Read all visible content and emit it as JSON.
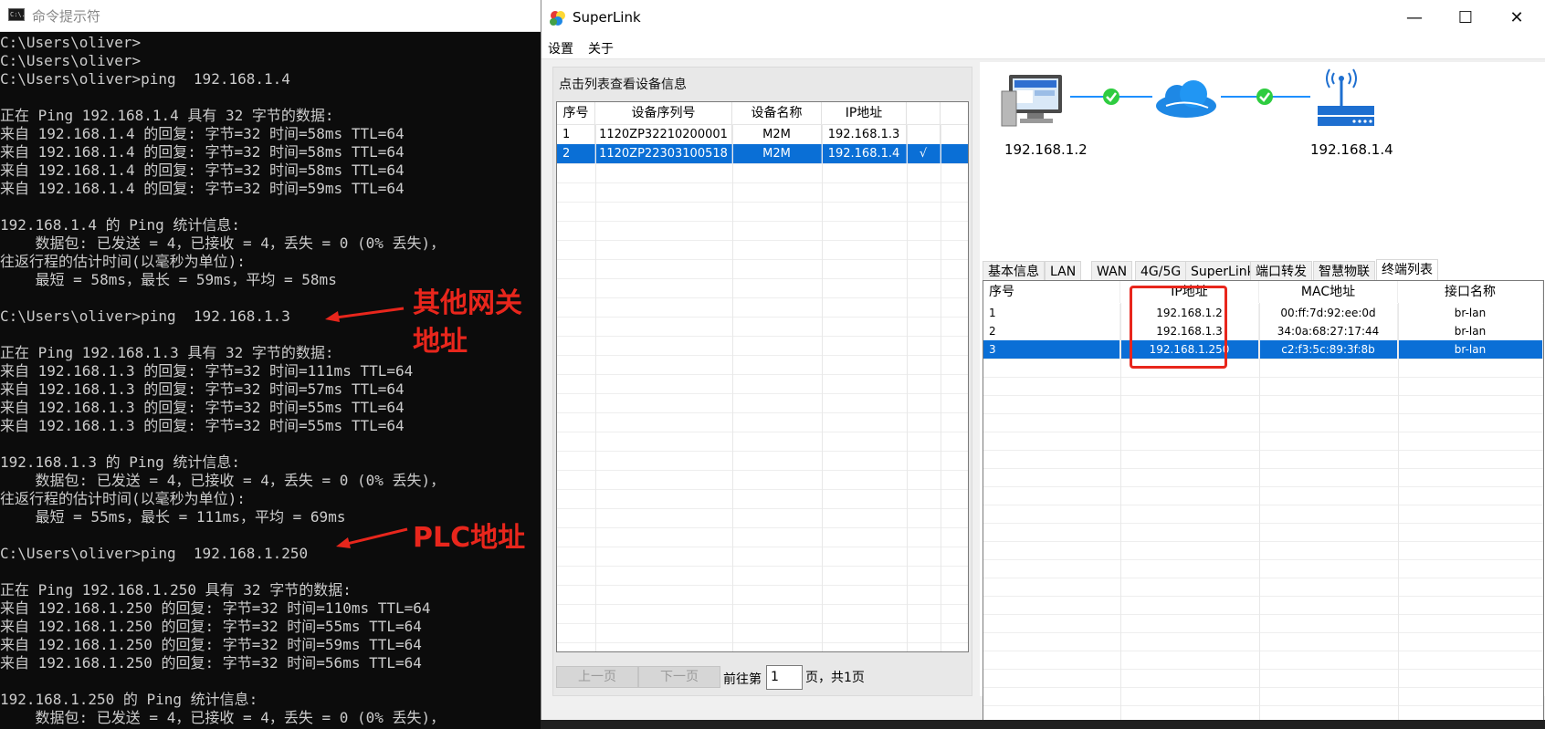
{
  "cmd": {
    "title": "命令提示符",
    "icon": "cmd-window-icon",
    "icon_text": "C:\\.",
    "lines": [
      "C:\\Users\\oliver>",
      "C:\\Users\\oliver>",
      "C:\\Users\\oliver>ping  192.168.1.4",
      "",
      "正在 Ping 192.168.1.4 具有 32 字节的数据:",
      "来自 192.168.1.4 的回复: 字节=32 时间=58ms TTL=64",
      "来自 192.168.1.4 的回复: 字节=32 时间=58ms TTL=64",
      "来自 192.168.1.4 的回复: 字节=32 时间=58ms TTL=64",
      "来自 192.168.1.4 的回复: 字节=32 时间=59ms TTL=64",
      "",
      "192.168.1.4 的 Ping 统计信息:",
      "    数据包: 已发送 = 4，已接收 = 4，丢失 = 0 (0% 丢失)，",
      "往返行程的估计时间(以毫秒为单位):",
      "    最短 = 58ms，最长 = 59ms，平均 = 58ms",
      "",
      "C:\\Users\\oliver>ping  192.168.1.3",
      "",
      "正在 Ping 192.168.1.3 具有 32 字节的数据:",
      "来自 192.168.1.3 的回复: 字节=32 时间=111ms TTL=64",
      "来自 192.168.1.3 的回复: 字节=32 时间=57ms TTL=64",
      "来自 192.168.1.3 的回复: 字节=32 时间=55ms TTL=64",
      "来自 192.168.1.3 的回复: 字节=32 时间=55ms TTL=64",
      "",
      "192.168.1.3 的 Ping 统计信息:",
      "    数据包: 已发送 = 4，已接收 = 4，丢失 = 0 (0% 丢失)，",
      "往返行程的估计时间(以毫秒为单位):",
      "    最短 = 55ms，最长 = 111ms，平均 = 69ms",
      "",
      "C:\\Users\\oliver>ping  192.168.1.250",
      "",
      "正在 Ping 192.168.1.250 具有 32 字节的数据:",
      "来自 192.168.1.250 的回复: 字节=32 时间=110ms TTL=64",
      "来自 192.168.1.250 的回复: 字节=32 时间=55ms TTL=64",
      "来自 192.168.1.250 的回复: 字节=32 时间=59ms TTL=64",
      "来自 192.168.1.250 的回复: 字节=32 时间=56ms TTL=64",
      "",
      "192.168.1.250 的 Ping 统计信息:",
      "    数据包: 已发送 = 4，已接收 = 4，丢失 = 0 (0% 丢失)，"
    ],
    "annotations": {
      "gateway_line1": "其他网关",
      "gateway_line2": "地址",
      "plc": "PLC地址",
      "color": "#e8261c"
    }
  },
  "superlink": {
    "title": "SuperLink",
    "window_controls": {
      "minimize": "—",
      "maximize": "☐",
      "close": "✕"
    },
    "menu": [
      "设置",
      "关于"
    ],
    "device_panel": {
      "caption": "点击列表查看设备信息",
      "columns": [
        "序号",
        "设备序列号",
        "设备名称",
        "IP地址"
      ],
      "rows": [
        {
          "no": "1",
          "serial": "1120ZP32210200001",
          "name": "M2M",
          "ip": "192.168.1.3",
          "check": ""
        },
        {
          "no": "2",
          "serial": "1120ZP22303100518",
          "name": "M2M",
          "ip": "192.168.1.4",
          "check": "√"
        }
      ],
      "selected_row": 2,
      "pagination": {
        "prev": "上一页",
        "next": "下一页",
        "before": "前往第",
        "page": "1",
        "after": "页，共1页"
      }
    },
    "topology": {
      "pc_ip": "192.168.1.2",
      "router_ip": "192.168.1.4",
      "status": [
        "connected-check-icon",
        "connected-check-icon"
      ]
    },
    "tabs": [
      "基本信息",
      "LAN",
      "WAN",
      "4G/5G",
      "SuperLink",
      "端口转发",
      "智慧物联",
      "终端列表"
    ],
    "active_tab": "终端列表",
    "terminal_table": {
      "columns": [
        "序号",
        "IP地址",
        "MAC地址",
        "接口名称"
      ],
      "rows": [
        {
          "no": "1",
          "ip": "192.168.1.2",
          "mac": "00:ff:7d:92:ee:0d",
          "iface": "br-lan"
        },
        {
          "no": "2",
          "ip": "192.168.1.3",
          "mac": "34:0a:68:27:17:44",
          "iface": "br-lan"
        },
        {
          "no": "3",
          "ip": "192.168.1.250",
          "mac": "c2:f3:5c:89:3f:8b",
          "iface": "br-lan"
        }
      ],
      "selected_row": 3
    },
    "colors": {
      "selection": "#0a6fd6",
      "highlight_box": "#e8261c",
      "status_ok": "#2ecc40",
      "cloud": "#1e88e5"
    }
  }
}
